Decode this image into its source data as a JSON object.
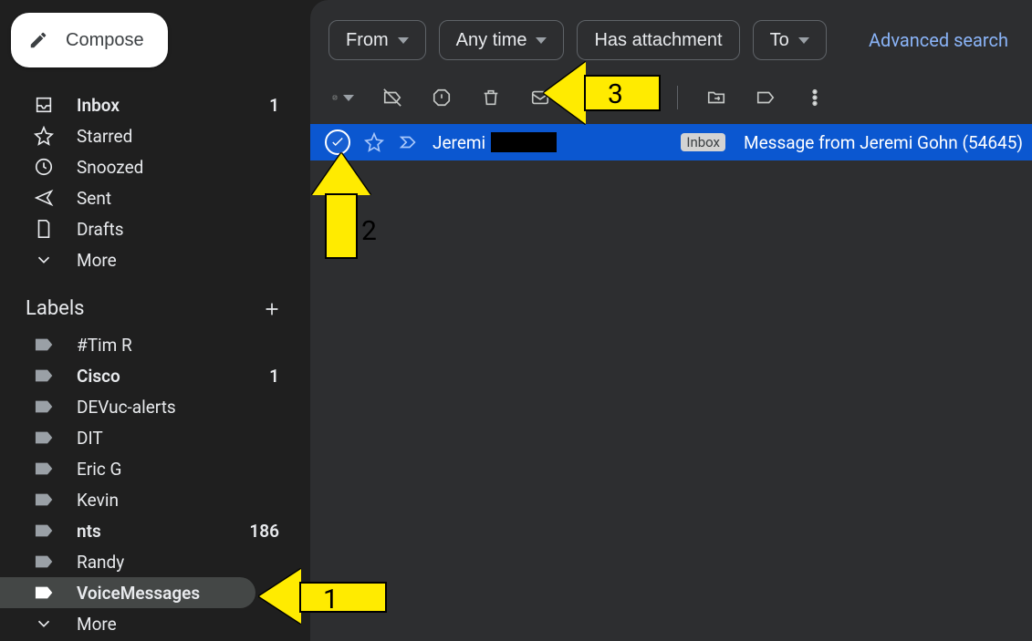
{
  "compose": "Compose",
  "nav": {
    "inbox": {
      "label": "Inbox",
      "count": "1"
    },
    "starred": {
      "label": "Starred"
    },
    "snoozed": {
      "label": "Snoozed"
    },
    "sent": {
      "label": "Sent"
    },
    "drafts": {
      "label": "Drafts"
    },
    "more": {
      "label": "More"
    }
  },
  "labels_header": "Labels",
  "labels": [
    {
      "name": "#Tim R"
    },
    {
      "name": "Cisco",
      "count": "1",
      "bold": true
    },
    {
      "name": "DEVuc-alerts"
    },
    {
      "name": "DIT"
    },
    {
      "name": "Eric G"
    },
    {
      "name": "Kevin"
    },
    {
      "name": "nts",
      "count": "186",
      "bold": true
    },
    {
      "name": "Randy"
    },
    {
      "name": "VoiceMessages",
      "highlight": true,
      "bold": true
    }
  ],
  "labels_more": "More",
  "chips": {
    "from": "From",
    "anytime": "Any time",
    "attachment": "Has attachment",
    "to": "To"
  },
  "adv_search": "Advanced search",
  "email": {
    "sender_visible": "Jeremi",
    "badge": "Inbox",
    "subject": "Message from Jeremi Gohn (54645)"
  },
  "annotations": {
    "a1": "1",
    "a2": "2",
    "a3": "3"
  }
}
